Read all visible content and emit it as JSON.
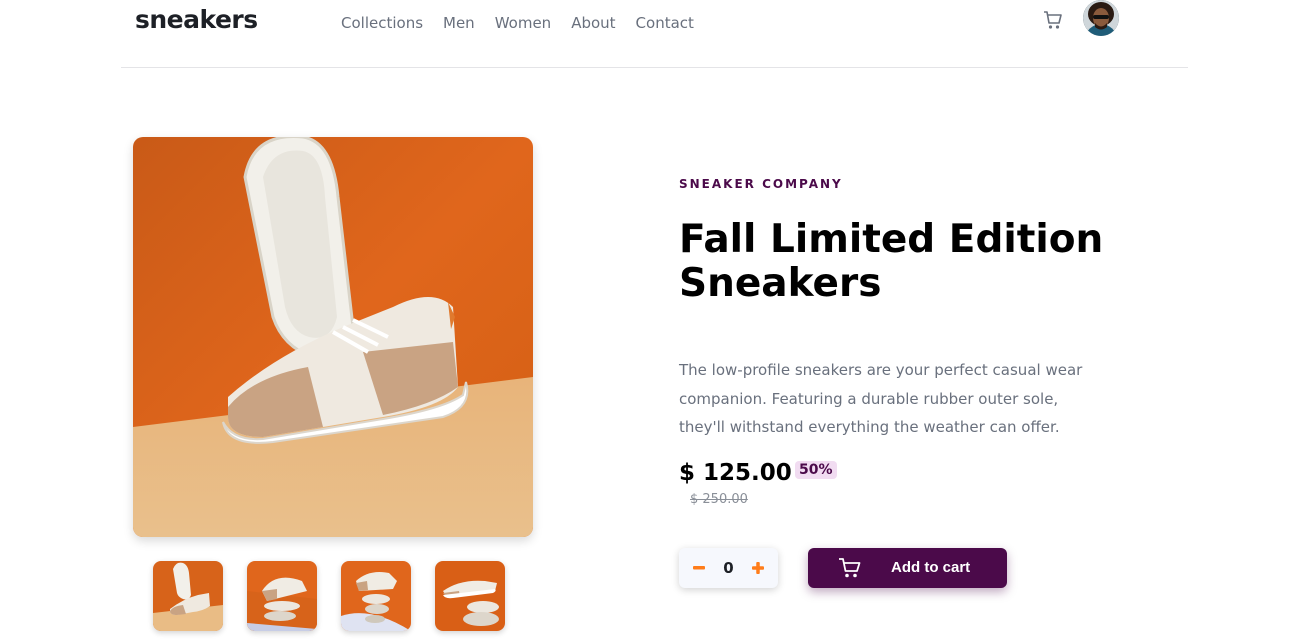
{
  "header": {
    "logo": "sneakers",
    "nav": [
      "Collections",
      "Men",
      "Women",
      "About",
      "Contact"
    ]
  },
  "product": {
    "company": "SNEAKER COMPANY",
    "title": "Fall Limited Edition Sneakers",
    "description": "The low-profile sneakers are your perfect casual wear companion. Featuring a durable rubber outer sole, they'll withstand everything the weather can offer.",
    "price": "$ 125.00",
    "discount": "50%",
    "old_price": "$ 250.00"
  },
  "cart": {
    "quantity": "0",
    "minus": "−",
    "plus": "+",
    "add_label": "Add to cart"
  },
  "colors": {
    "accent": "#4b0a4a",
    "orange": "#ff7d1a",
    "text_muted": "#69707d"
  },
  "icons": {
    "cart": "cart-icon",
    "avatar": "avatar-image",
    "minus": "minus-icon",
    "plus": "plus-icon"
  }
}
